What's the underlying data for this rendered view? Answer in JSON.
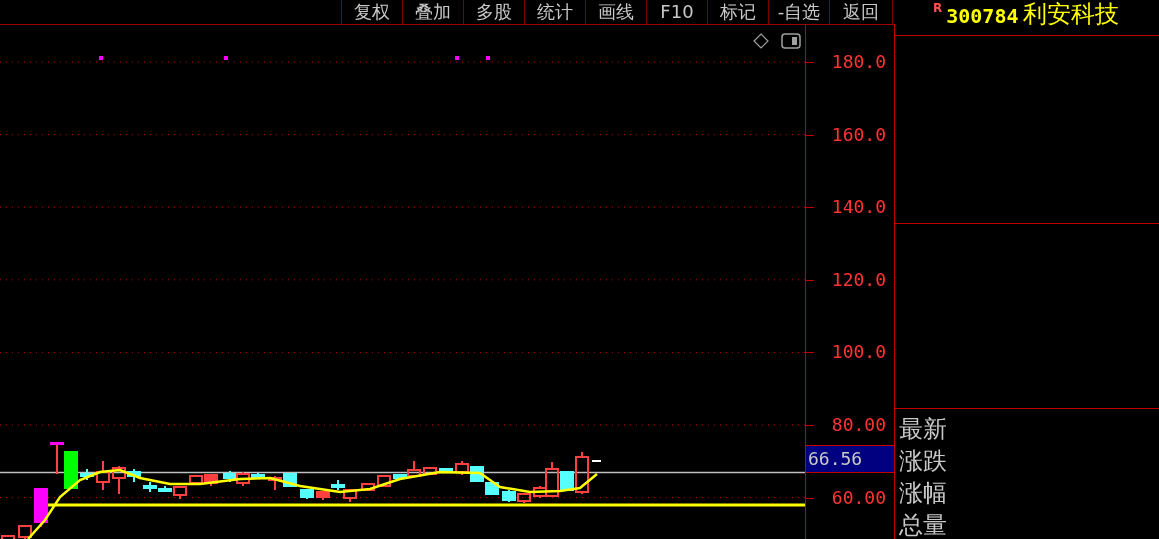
{
  "toolbar": [
    {
      "label": "复权"
    },
    {
      "label": "叠加"
    },
    {
      "label": "多股"
    },
    {
      "label": "统计"
    },
    {
      "label": "画线"
    },
    {
      "label": "F10"
    },
    {
      "label": "标记"
    },
    {
      "label": "-自选"
    },
    {
      "label": "返回"
    }
  ],
  "price_axis": {
    "labels": [
      "180.0",
      "160.0",
      "140.0",
      "120.0",
      "100.0",
      "80.00",
      "60.00"
    ],
    "current_price": "66.56"
  },
  "stock": {
    "market_mark": "R",
    "code": "300784",
    "name": "利安科技"
  },
  "quote_labels": [
    "最新",
    "涨跌",
    "涨幅",
    "总量"
  ]
}
